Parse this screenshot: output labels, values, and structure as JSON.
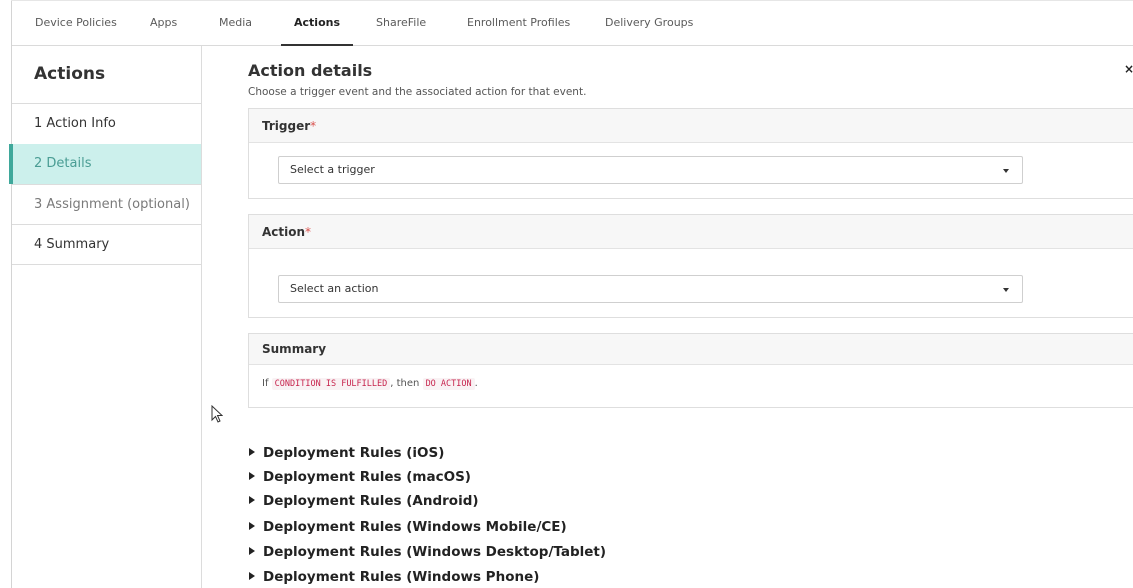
{
  "nav": {
    "tabs": [
      "Device Policies",
      "Apps",
      "Media",
      "Actions",
      "ShareFile",
      "Enrollment Profiles",
      "Delivery Groups"
    ],
    "active_tab": "Actions"
  },
  "sidebar": {
    "title": "Actions",
    "steps": [
      {
        "label": "1 Action Info",
        "state": "normal"
      },
      {
        "label": "2 Details",
        "state": "active"
      },
      {
        "label": "3 Assignment (optional)",
        "state": "disabled"
      },
      {
        "label": "4 Summary",
        "state": "normal"
      }
    ]
  },
  "main": {
    "title": "Action details",
    "subtitle": "Choose a trigger event and the associated action for that event.",
    "close_glyph": "×",
    "trigger": {
      "label": "Trigger",
      "required_mark": "*",
      "placeholder": "Select a trigger"
    },
    "action": {
      "label": "Action",
      "required_mark": "*",
      "placeholder": "Select an action"
    },
    "summary": {
      "label": "Summary",
      "prefix": "If",
      "condition": "CONDITION IS FULFILLED",
      "middle": ", then",
      "action": "DO ACTION",
      "suffix": "."
    },
    "deployment_rules": [
      "Deployment Rules (iOS)",
      "Deployment Rules (macOS)",
      "Deployment Rules (Android)",
      "Deployment Rules (Windows Mobile/CE)",
      "Deployment Rules (Windows Desktop/Tablet)",
      "Deployment Rules (Windows Phone)"
    ]
  },
  "colors": {
    "active_step_bg": "#ccf0ec",
    "active_step_text": "#4a9d94",
    "active_step_bar": "#3fa89b",
    "required": "#d9534f",
    "code_text": "#c7254e",
    "code_bg": "#f9f2f4"
  },
  "icons": {
    "close": "close-icon",
    "dropdown": "chevron-down-icon",
    "expand": "triangle-right-icon",
    "pointer": "mouse-pointer-icon"
  }
}
